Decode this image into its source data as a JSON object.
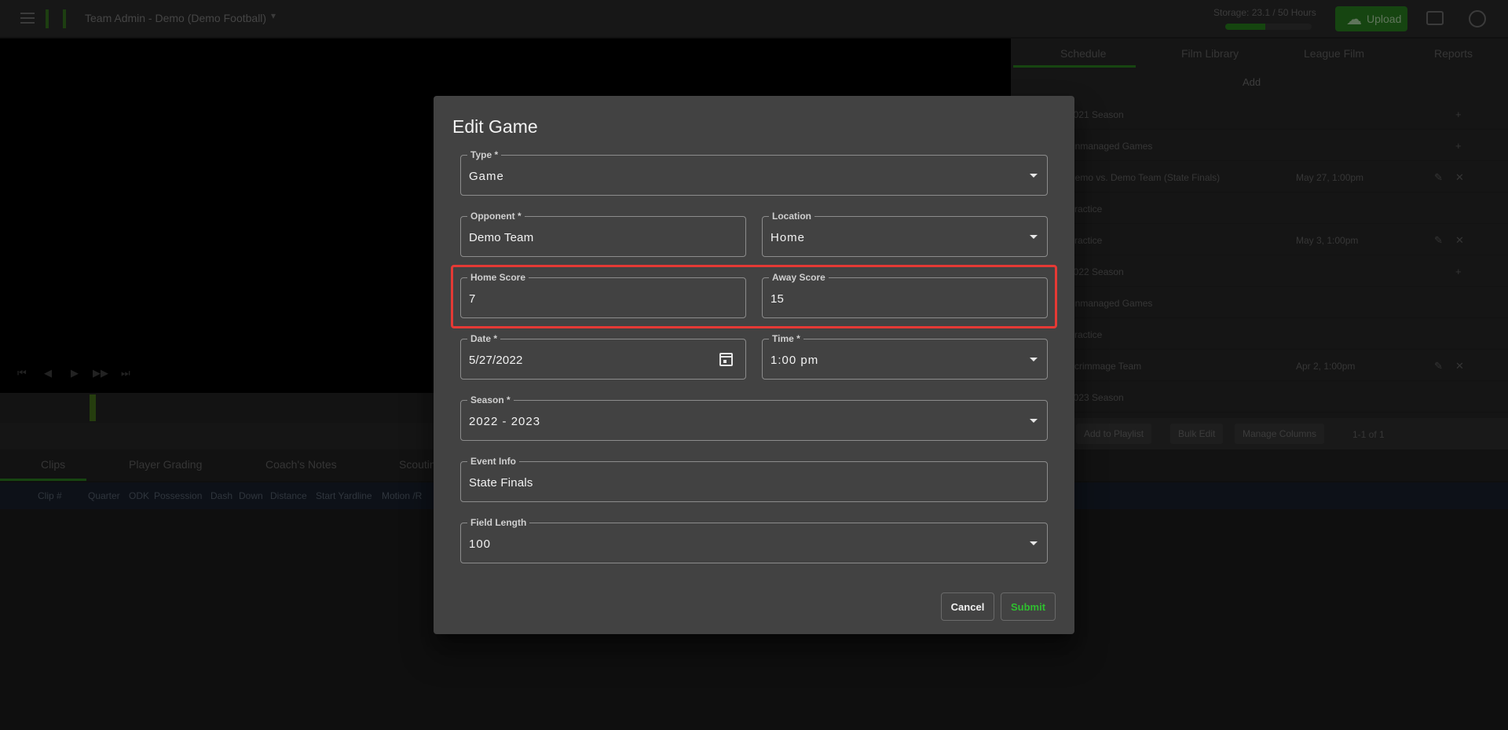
{
  "app": {
    "team_title": "Team Admin - Demo (Demo Football)",
    "storage_label": "Storage: 23.1 / 50 Hours",
    "storage_used_fraction": 0.46,
    "upload_label": "Upload"
  },
  "video_controls": [
    "⏮",
    "◀",
    "▶",
    "▶▶",
    "⏭"
  ],
  "bottom_tabs": [
    "Clips",
    "Player Grading",
    "Coach's Notes",
    "Scouting"
  ],
  "filters": [
    "Clip #",
    "Quarter",
    "ODK",
    "Possession",
    "Dash",
    "Down",
    "Distance",
    "Start Yardline",
    "Motion /R"
  ],
  "right_panel": {
    "tabs": [
      "Schedule",
      "Film Library",
      "League Film",
      "Reports"
    ],
    "add_label": "Add",
    "rows": [
      {
        "text": "2021 Season",
        "date": ""
      },
      {
        "text": "Unmanaged Games",
        "date": ""
      },
      {
        "text": "Demo vs. Demo Team (State Finals)",
        "date": "May 27, 1:00pm"
      },
      {
        "text": "Practice",
        "date": ""
      },
      {
        "text": "Practice",
        "date": "May 3, 1:00pm"
      },
      {
        "text": "2022 Season",
        "date": ""
      },
      {
        "text": "Unmanaged Games",
        "date": ""
      },
      {
        "text": "Practice",
        "date": ""
      },
      {
        "text": "Scrimmage Team",
        "date": "Apr 2, 1:00pm"
      },
      {
        "text": "2023 Season",
        "date": ""
      }
    ],
    "bottom_buttons": [
      "Add to Playlist",
      "Bulk Edit",
      "Manage Columns"
    ],
    "pagination": "1-1 of 1"
  },
  "dialog": {
    "title": "Edit Game",
    "type": {
      "label": "Type *",
      "value": "Game"
    },
    "opponent": {
      "label": "Opponent *",
      "value": "Demo Team"
    },
    "location": {
      "label": "Location",
      "value": "Home"
    },
    "home_score": {
      "label": "Home Score",
      "value": "7"
    },
    "away_score": {
      "label": "Away Score",
      "value": "15"
    },
    "date": {
      "label": "Date *",
      "value": "5/27/2022"
    },
    "time": {
      "label": "Time *",
      "value": "1:00 pm"
    },
    "season": {
      "label": "Season *",
      "value": "2022 - 2023"
    },
    "event_info": {
      "label": "Event Info",
      "value": "State Finals"
    },
    "field_length": {
      "label": "Field Length",
      "value": "100"
    },
    "cancel_label": "Cancel",
    "submit_label": "Submit"
  },
  "colors": {
    "accent": "#2fbf2f",
    "brand_green": "#2c8a22",
    "highlight": "#e53935",
    "dialog_bg": "#424242"
  }
}
